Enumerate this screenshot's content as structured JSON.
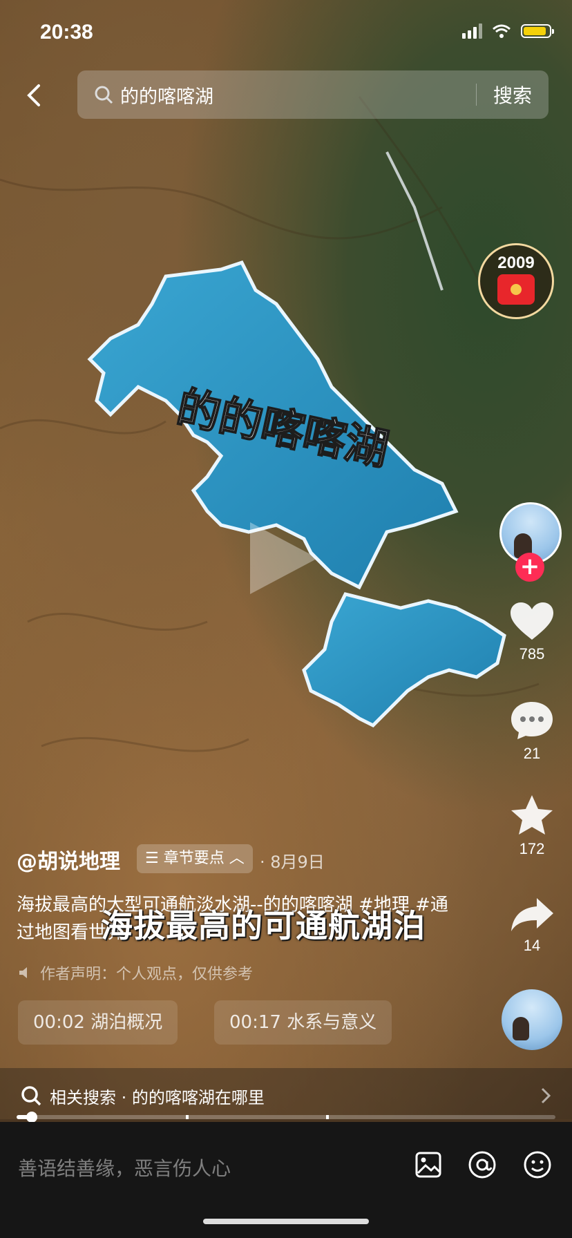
{
  "status": {
    "time": "20:38"
  },
  "search": {
    "query": "的的喀喀湖",
    "button": "搜索"
  },
  "badge": {
    "count": "2009"
  },
  "map": {
    "lake_label": "的的喀喀湖"
  },
  "actions": {
    "likes": "785",
    "comments": "21",
    "favorites": "172",
    "shares": "14"
  },
  "video": {
    "author": "@胡说地理",
    "chapter_chip": "章节要点",
    "date": "· 8月9日",
    "description": "海拔最高的大型可通航淡水湖--的的喀喀湖 #地理 #通过地图看世界",
    "overlay_caption": "海拔最高的可通航湖泊",
    "disclaimer": "作者声明：个人观点，仅供参考",
    "chapters": [
      {
        "label": "00:02 湖泊概况"
      },
      {
        "label": "00:17 水系与意义"
      }
    ]
  },
  "related": {
    "text": "相关搜索 · 的的喀喀湖在哪里"
  },
  "progress": {
    "played_fraction": 0.03
  },
  "comment": {
    "placeholder": "善语结善缘，恶言伤人心"
  },
  "colors": {
    "lake": "#2f93c4",
    "like_red": "#fe2c55"
  }
}
